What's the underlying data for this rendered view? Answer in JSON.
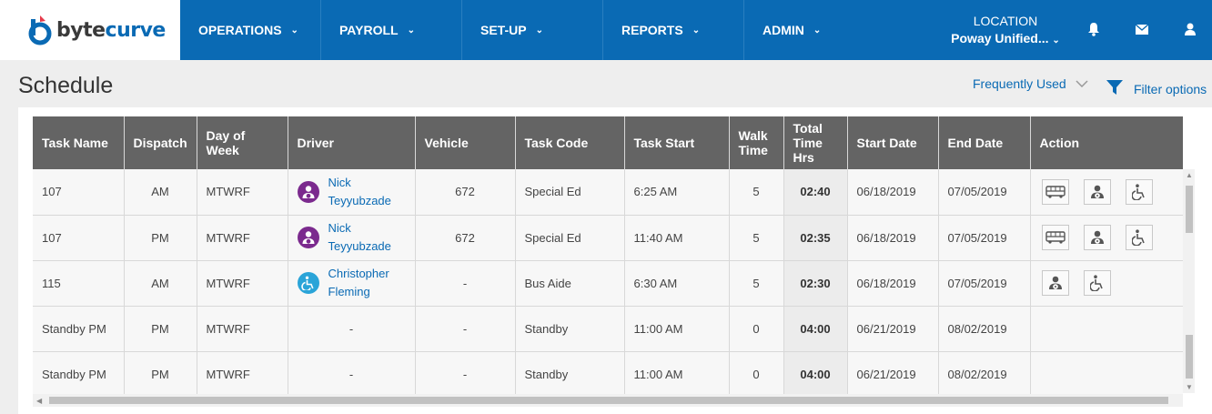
{
  "brand": {
    "name_part1": "byte",
    "name_part2": "curve",
    "accent": "#0a6ab4"
  },
  "nav": [
    {
      "label": "OPERATIONS"
    },
    {
      "label": "PAYROLL"
    },
    {
      "label": "SET-UP"
    },
    {
      "label": "REPORTS"
    },
    {
      "label": "ADMIN"
    }
  ],
  "location": {
    "label": "LOCATION",
    "value": "Poway Unified..."
  },
  "icons": {
    "notifications": "bell-icon",
    "messages": "envelope-icon",
    "profile": "user-icon"
  },
  "page": {
    "title": "Schedule"
  },
  "toolbar": {
    "frequently_used": "Frequently Used",
    "filter_options": "Filter options"
  },
  "table": {
    "columns": [
      "Task Name",
      "Dispatch",
      "Day of Week",
      "Driver",
      "Vehicle",
      "Task Code",
      "Task Start",
      "Walk Time",
      "Total Time Hrs",
      "Start Date",
      "End Date",
      "Action"
    ],
    "rows": [
      {
        "task_name": "107",
        "dispatch": "AM",
        "day_of_week": "MTWRF",
        "driver_first": "Nick",
        "driver_last": "Teyyubzade",
        "driver_type": "driver",
        "vehicle": "672",
        "task_code": "Special Ed",
        "task_start": "6:25 AM",
        "walk_time": "5",
        "total_time": "02:40",
        "start_date": "06/18/2019",
        "end_date": "07/05/2019",
        "actions": [
          "bus",
          "driver",
          "wheelchair"
        ]
      },
      {
        "task_name": "107",
        "dispatch": "PM",
        "day_of_week": "MTWRF",
        "driver_first": "Nick",
        "driver_last": "Teyyubzade",
        "driver_type": "driver",
        "vehicle": "672",
        "task_code": "Special Ed",
        "task_start": "11:40 AM",
        "walk_time": "5",
        "total_time": "02:35",
        "start_date": "06/18/2019",
        "end_date": "07/05/2019",
        "actions": [
          "bus",
          "driver",
          "wheelchair"
        ]
      },
      {
        "task_name": "115",
        "dispatch": "AM",
        "day_of_week": "MTWRF",
        "driver_first": "Christopher",
        "driver_last": "Fleming",
        "driver_type": "aide",
        "vehicle": "-",
        "task_code": "Bus Aide",
        "task_start": "6:30 AM",
        "walk_time": "5",
        "total_time": "02:30",
        "start_date": "06/18/2019",
        "end_date": "07/05/2019",
        "actions": [
          "driver",
          "wheelchair"
        ]
      },
      {
        "task_name": "Standby PM",
        "dispatch": "PM",
        "day_of_week": "MTWRF",
        "driver_first": "",
        "driver_last": "",
        "driver_type": "none",
        "driver_placeholder": "-",
        "vehicle": "-",
        "task_code": "Standby",
        "task_start": "11:00 AM",
        "walk_time": "0",
        "total_time": "04:00",
        "start_date": "06/21/2019",
        "end_date": "08/02/2019",
        "actions": []
      },
      {
        "task_name": "Standby PM",
        "dispatch": "PM",
        "day_of_week": "MTWRF",
        "driver_first": "",
        "driver_last": "",
        "driver_type": "none",
        "driver_placeholder": "-",
        "vehicle": "-",
        "task_code": "Standby",
        "task_start": "11:00 AM",
        "walk_time": "0",
        "total_time": "04:00",
        "start_date": "06/21/2019",
        "end_date": "08/02/2019",
        "actions": []
      }
    ]
  },
  "colors": {
    "driver_avatar": "#7b2a8e",
    "aide_avatar": "#2aa4d8",
    "header_bg": "#646464"
  }
}
